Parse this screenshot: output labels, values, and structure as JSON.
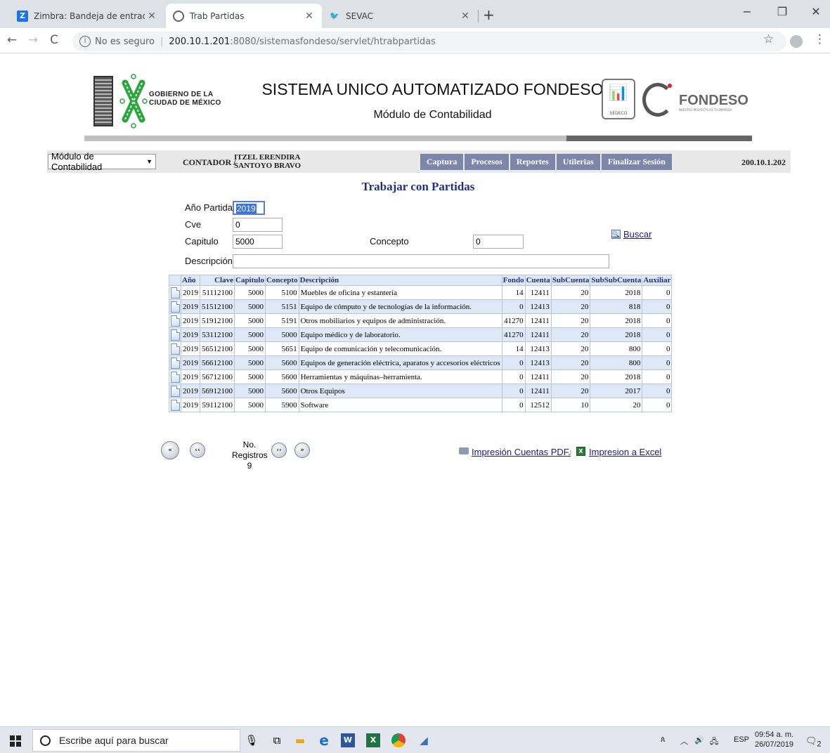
{
  "browser": {
    "tabs": [
      {
        "title": "Zimbra: Bandeja de entrada",
        "favicon": "zimbra-icon"
      },
      {
        "title": "Trab Partidas",
        "favicon": "globe-icon",
        "active": true
      },
      {
        "title": "SEVAC",
        "favicon": "sevac-icon"
      }
    ],
    "security_label": "No es seguro",
    "url_host": "200.10.1.201",
    "url_path": ":8080/sistemasfondeso/servlet/htrabpartidas"
  },
  "header": {
    "gov_text_line1": "GOBIERNO DE LA",
    "gov_text_line2": "CIUDAD DE MÉXICO",
    "title": "SISTEMA UNICO AUTOMATIZADO FONDESO",
    "subtitle": "Módulo de Contabilidad",
    "sedeco_label": "SEDECO",
    "fondeso_word": "FONDESO",
    "fondeso_tagline": "NUESTRO PROYECTO ES TU EMPRESA"
  },
  "menubar": {
    "module_selected": "Módulo de Contabilidad",
    "user_role": "CONTADOR /",
    "user_name": "ITZEL ERENDIRA SANTOYO BRAVO",
    "items": [
      "Captura",
      "Procesos",
      "Reportes",
      "Utilerias",
      "Finalizar Sesión"
    ],
    "ip": "200.10.1.202"
  },
  "form": {
    "heading": "Trabajar con Partidas",
    "anio_label": "Año Partida",
    "anio_value": "2019",
    "cve_label": "Cve",
    "cve_value": "0",
    "capitulo_label": "Capitulo",
    "capitulo_value": "5000",
    "concepto_label": "Concepto",
    "concepto_value": "0",
    "descripcion_label": "Descripción",
    "descripcion_value": "",
    "buscar_label": "Buscar"
  },
  "table": {
    "columns": [
      "Año",
      "Clave",
      "Capitulo",
      "Concepto",
      "Descripción",
      "Fondo",
      "Cuenta",
      "SubCuenta",
      "SubSubCuenta",
      "Auxiliar"
    ],
    "rows": [
      [
        "2019",
        "51112100",
        "5000",
        "5100",
        "Muebles de oficina y estantería",
        "14",
        "12411",
        "20",
        "2018",
        "0"
      ],
      [
        "2019",
        "51512100",
        "5000",
        "5151",
        "Equipo de cómputo y de tecnologías de la información.",
        "0",
        "12413",
        "20",
        "818",
        "0"
      ],
      [
        "2019",
        "51912100",
        "5000",
        "5191",
        "Otros mobiliarios y equipos de administración.",
        "41270",
        "12411",
        "20",
        "2018",
        "0"
      ],
      [
        "2019",
        "53112100",
        "5000",
        "5000",
        "Equipo médico y de laboratorio.",
        "41270",
        "12411",
        "20",
        "2018",
        "0"
      ],
      [
        "2019",
        "56512100",
        "5000",
        "5651",
        "Equipo de comunicación y telecomunicación.",
        "14",
        "12413",
        "20",
        "800",
        "0"
      ],
      [
        "2019",
        "56612100",
        "5000",
        "5600",
        "Equipos de generación eléctrica, aparatos y accesorios eléctricos",
        "0",
        "12413",
        "20",
        "800",
        "0"
      ],
      [
        "2019",
        "56712100",
        "5000",
        "5600",
        "Herramientas y máquinas–herramienta.",
        "0",
        "12411",
        "20",
        "2018",
        "0"
      ],
      [
        "2019",
        "56912100",
        "5000",
        "5600",
        "Otros Equipos",
        "0",
        "12411",
        "20",
        "2017",
        "0"
      ],
      [
        "2019",
        "59112100",
        "5000",
        "5900",
        "Software",
        "0",
        "12512",
        "10",
        "20",
        "0"
      ]
    ]
  },
  "pager": {
    "label": "No. Registros",
    "count": "9",
    "btn_first": "«",
    "btn_prev": "‹‹",
    "btn_next": "››",
    "btn_last": "»"
  },
  "links": {
    "pdf": "Impresión Cuentas PDF.",
    "excel": "Impresion a Excel"
  },
  "taskbar": {
    "search_placeholder": "Escribe aquí para buscar",
    "lang": "ESP",
    "time": "09:54 a. m.",
    "date": "26/07/2019",
    "notif_count": "2"
  },
  "colors": {
    "accent_blue": "#1e2f8f",
    "menu_bg": "#7b86aa",
    "row_alt": "#dfe8f6"
  }
}
